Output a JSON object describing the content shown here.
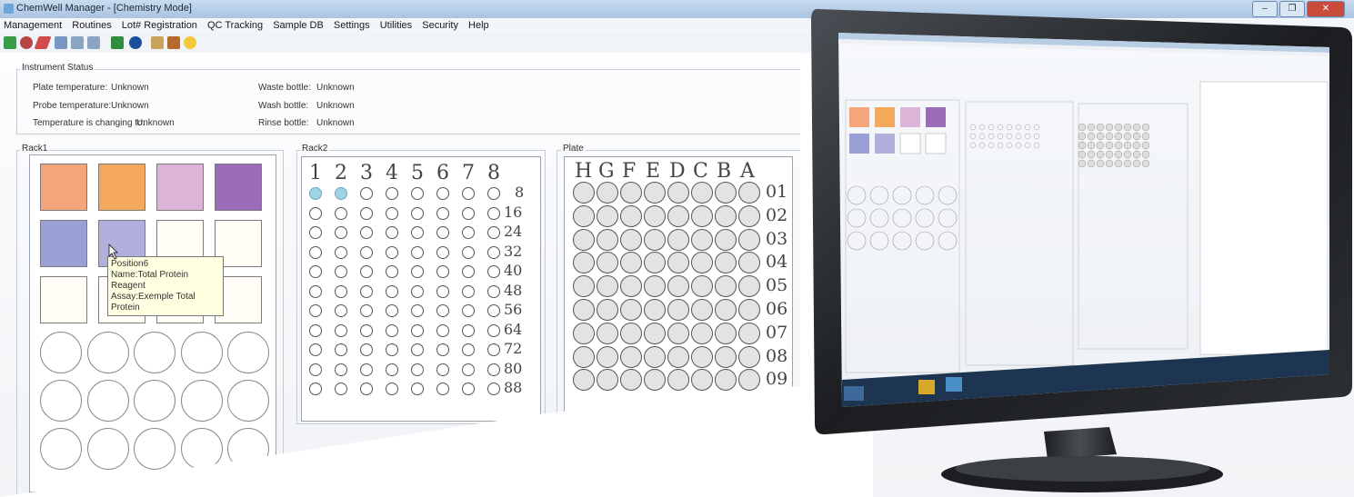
{
  "window": {
    "title": "ChemWell Manager - [Chemistry Mode]",
    "buttons": [
      "–",
      "❐",
      "✕"
    ]
  },
  "menu": [
    "Management",
    "Routines",
    "Lot# Registration",
    "QC Tracking",
    "Sample DB",
    "Settings",
    "Utilities",
    "Security",
    "Help"
  ],
  "toolbar_icons": [
    "grid-icon",
    "robot-icon",
    "pipette-icon",
    "calendar-icon",
    "export-icon",
    "import-icon",
    "green-square-icon",
    "info-icon",
    "edit-icon",
    "book-icon",
    "smiley-icon"
  ],
  "instrument_status": {
    "legend": "Instrument Status",
    "rows": [
      {
        "label": "Plate temperature:",
        "value": "Unknown",
        "label2": "Waste bottle:",
        "value2": "Unknown"
      },
      {
        "label": "Probe temperature:",
        "value": "Unknown",
        "label2": "Wash bottle:",
        "value2": "Unknown"
      },
      {
        "label": "Temperature is changing to:",
        "value": "Unknown",
        "label2": "Rinse bottle:",
        "value2": "Unknown"
      }
    ]
  },
  "rack1": {
    "legend": "Rack1",
    "squares": [
      "#f4a57a",
      "#f4a85c",
      "#dcb4d8",
      "#9b6db8",
      "#9aa0d6",
      "#b1b0dc",
      "#fffdf5",
      "#fffdf5",
      "#fffdf5",
      "#fffdf5",
      "#fffdf5",
      "#fffdf5"
    ]
  },
  "tooltip": {
    "line1": "Position6",
    "line2": "Name:Total Protein Reagent",
    "line3": "Assay:Exemple Total Protein"
  },
  "rack2": {
    "legend": "Rack2",
    "columns": [
      "1",
      "2",
      "3",
      "4",
      "5",
      "6",
      "7",
      "8"
    ],
    "rows": [
      "8",
      "16",
      "24",
      "32",
      "40",
      "48",
      "56",
      "64",
      "72",
      "80",
      "88"
    ],
    "filled_color": "#9ed4e3"
  },
  "plate": {
    "legend": "Plate",
    "columns": [
      "H",
      "G",
      "F",
      "E",
      "D",
      "C",
      "B",
      "A"
    ],
    "rows": [
      "01",
      "02",
      "03",
      "04",
      "05",
      "06",
      "07",
      "08",
      "09"
    ]
  },
  "colors": {
    "accent": "#a9c4e2",
    "close": "#c94b3b"
  }
}
